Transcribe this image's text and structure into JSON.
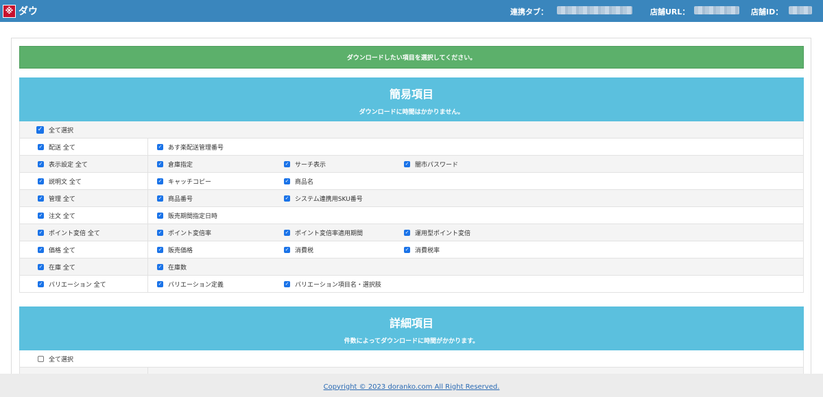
{
  "header": {
    "logo_glyph": "※",
    "title": "ダウ",
    "link_tab_label": "連携タブ：",
    "shop_url_label": "店舗URL：",
    "shop_id_label": "店舗ID："
  },
  "alert": {
    "message": "ダウンロードしたい項目を選択してください。"
  },
  "simple": {
    "heading": "簡易項目",
    "subheading": "ダウンロードに時間はかかりません。",
    "select_all_label": "全て選択",
    "rows": [
      {
        "group": "配送 全て",
        "items": [
          "あす楽配送管理番号"
        ]
      },
      {
        "group": "表示設定 全て",
        "items": [
          "倉庫指定",
          "サーチ表示",
          "闇市パスワード"
        ]
      },
      {
        "group": "説明文 全て",
        "items": [
          "キャッチコピー",
          "商品名"
        ]
      },
      {
        "group": "管理 全て",
        "items": [
          "商品番号",
          "システム連携用SKU番号"
        ]
      },
      {
        "group": "注文 全て",
        "items": [
          "販売期間指定日時"
        ]
      },
      {
        "group": "ポイント変倍 全て",
        "items": [
          "ポイント変倍率",
          "ポイント変倍率適用期間",
          "運用型ポイント変倍"
        ]
      },
      {
        "group": "価格 全て",
        "items": [
          "販売価格",
          "消費税",
          "消費税率"
        ]
      },
      {
        "group": "在庫 全て",
        "items": [
          "在庫数"
        ]
      },
      {
        "group": "バリエーション 全て",
        "items": [
          "バリエーション定義",
          "バリエーション項目名・選択肢"
        ]
      }
    ]
  },
  "detail": {
    "heading": "詳細項目",
    "subheading": "件数によってダウンロードに時間がかかります。",
    "select_all_label": "全て選択"
  },
  "footer": {
    "copyright": "Copyright © 2023 doranko.com All Right Reserved."
  },
  "colors": {
    "header": "#3a86bd",
    "alert": "#5cb06b",
    "section": "#5bc0de",
    "checkbox": "#1a73e8"
  }
}
